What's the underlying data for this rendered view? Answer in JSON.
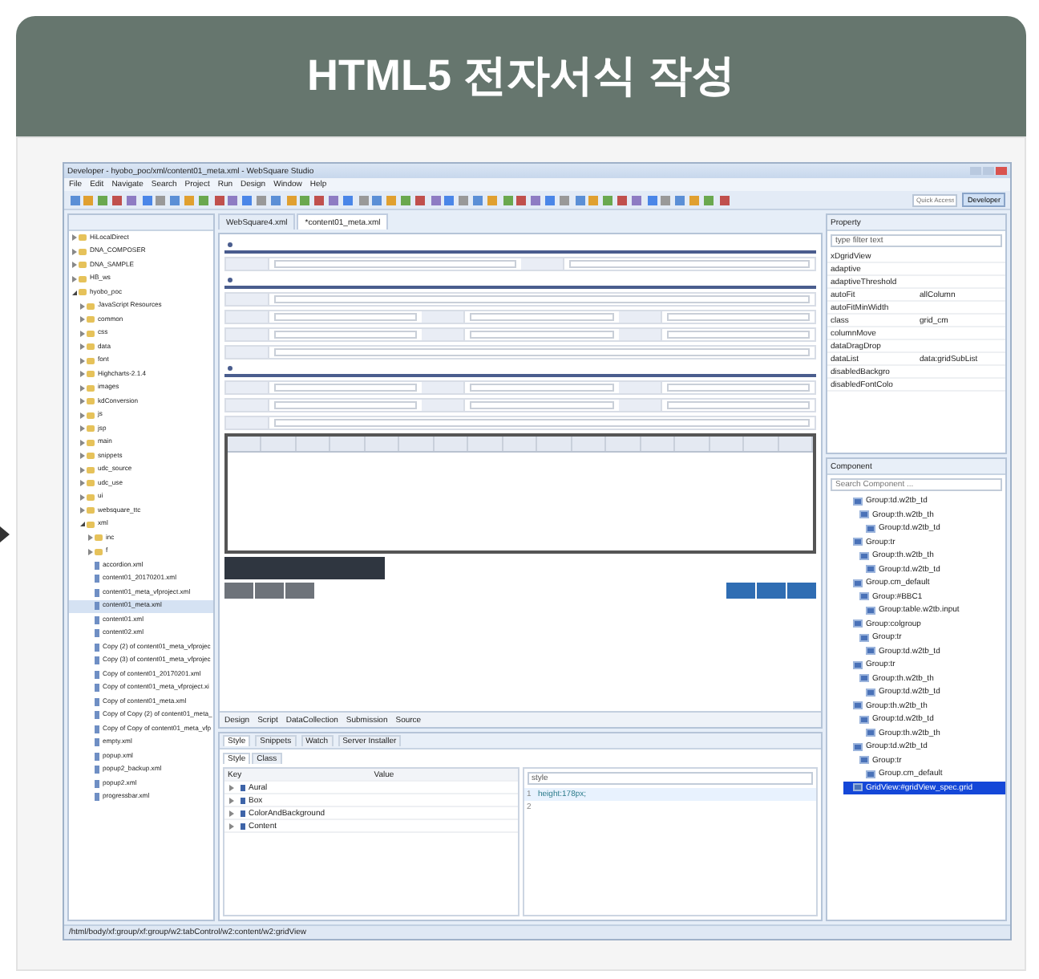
{
  "header": {
    "title": "HTML5 전자서식 작성"
  },
  "ide": {
    "title": "Developer - hyobo_poc/xml/content01_meta.xml - WebSquare Studio",
    "menu": [
      "File",
      "Edit",
      "Navigate",
      "Search",
      "Project",
      "Run",
      "Design",
      "Window",
      "Help"
    ],
    "quick_access": {
      "placeholder": "Quick Access"
    },
    "perspective": "Developer",
    "navigator": {
      "tree": [
        {
          "label": "HiLocalDirect",
          "expanded": false
        },
        {
          "label": "DNA_COMPOSER",
          "expanded": false
        },
        {
          "label": "DNA_SAMPLE",
          "expanded": false
        },
        {
          "label": "HB_ws",
          "expanded": false
        },
        {
          "label": "hyobo_poc",
          "expanded": true,
          "children": [
            {
              "label": "JavaScript Resources",
              "expanded": false
            },
            {
              "label": "common",
              "expanded": false
            },
            {
              "label": "css",
              "expanded": false
            },
            {
              "label": "data",
              "expanded": false
            },
            {
              "label": "font",
              "expanded": false
            },
            {
              "label": "Highcharts-2.1.4",
              "expanded": false
            },
            {
              "label": "images",
              "expanded": false
            },
            {
              "label": "kdConversion",
              "expanded": false
            },
            {
              "label": "js",
              "expanded": false
            },
            {
              "label": "jsp",
              "expanded": false
            },
            {
              "label": "main",
              "expanded": false
            },
            {
              "label": "snippets",
              "expanded": false
            },
            {
              "label": "udc_source",
              "expanded": false
            },
            {
              "label": "udc_use",
              "expanded": false
            },
            {
              "label": "ui",
              "expanded": false
            },
            {
              "label": "websquare_ttc",
              "expanded": false
            },
            {
              "label": "xml",
              "expanded": true,
              "children": [
                {
                  "label": "inc",
                  "expanded": false
                },
                {
                  "label": "f",
                  "expanded": false
                },
                {
                  "label": "accordion.xml",
                  "selected": false
                },
                {
                  "label": "content01_20170201.xml",
                  "selected": false
                },
                {
                  "label": "content01_meta_vfproject.xml",
                  "selected": false
                },
                {
                  "label": "content01_meta.xml",
                  "selected": true
                },
                {
                  "label": "content01.xml",
                  "selected": false
                },
                {
                  "label": "content02.xml",
                  "selected": false
                },
                {
                  "label": "Copy (2) of content01_meta_vfprojec",
                  "selected": false
                },
                {
                  "label": "Copy (3) of content01_meta_vfprojec",
                  "selected": false
                },
                {
                  "label": "Copy of content01_20170201.xml",
                  "selected": false
                },
                {
                  "label": "Copy of content01_meta_vfproject.xi",
                  "selected": false
                },
                {
                  "label": "Copy of content01_meta.xml",
                  "selected": false
                },
                {
                  "label": "Copy of Copy (2) of content01_meta_",
                  "selected": false
                },
                {
                  "label": "Copy of Copy of content01_meta_vfp",
                  "selected": false
                },
                {
                  "label": "empty.xml",
                  "selected": false
                },
                {
                  "label": "popup.xml",
                  "selected": false
                },
                {
                  "label": "popup2_backup.xml",
                  "selected": false
                },
                {
                  "label": "popup2.xml",
                  "selected": false
                },
                {
                  "label": "progressbar.xml",
                  "selected": false
                }
              ]
            }
          ]
        }
      ]
    },
    "editor_tabs": [
      {
        "label": "WebSquare4.xml",
        "selected": false
      },
      {
        "label": "*content01_meta.xml",
        "selected": true
      }
    ],
    "bottom_tabs": [
      "Design",
      "Script",
      "DataCollection",
      "Submission",
      "Source"
    ],
    "style_view": {
      "tabs": [
        {
          "label": "Style",
          "selected": true
        },
        {
          "label": "Snippets",
          "selected": false
        },
        {
          "label": "Watch",
          "selected": false
        },
        {
          "label": "Server Installer",
          "selected": false
        }
      ],
      "subtabs": [
        {
          "label": "Style",
          "selected": true
        },
        {
          "label": "Class",
          "selected": false
        }
      ],
      "columns": [
        "Key",
        "Value"
      ],
      "keys": [
        "Aural",
        "Box",
        "ColorAndBackground",
        "Content"
      ],
      "selector": "style",
      "code": [
        {
          "line": "1",
          "text": "height:178px;"
        },
        {
          "line": "2"
        }
      ]
    },
    "property": {
      "title": "Property",
      "filter": "type filter text",
      "rows": [
        {
          "key": "xDgridView"
        },
        {
          "key": "adaptive"
        },
        {
          "key": "adaptiveThreshold"
        },
        {
          "key": "autoFit",
          "value": "allColumn"
        },
        {
          "key": "autoFitMinWidth"
        },
        {
          "key": "class",
          "value": "grid_cm"
        },
        {
          "key": "columnMove"
        },
        {
          "key": "dataDragDrop"
        },
        {
          "key": "dataList",
          "value": "data:gridSubList"
        },
        {
          "key": "disabledBackgro"
        },
        {
          "key": "disabledFontColo"
        }
      ]
    },
    "component": {
      "title": "Component",
      "search": {
        "placeholder": "Search Component ..."
      },
      "tree": [
        {
          "label": "Group:td.w2tb_td",
          "selected": false
        },
        {
          "label": "Group:th.w2tb_th",
          "selected": false
        },
        {
          "label": "Group:td.w2tb_td",
          "selected": false
        },
        {
          "label": "Group:tr",
          "selected": false
        },
        {
          "label": "Group:th.w2tb_th",
          "selected": false
        },
        {
          "label": "Group:td.w2tb_td",
          "selected": false
        },
        {
          "label": "Group.cm_default",
          "selected": false
        },
        {
          "label": "Group:#BBC1",
          "selected": false
        },
        {
          "label": "Group:table.w2tb.input",
          "selected": false
        },
        {
          "label": "Group:colgroup",
          "selected": false
        },
        {
          "label": "Group:tr",
          "selected": false
        },
        {
          "label": "Group:td.w2tb_td",
          "selected": false
        },
        {
          "label": "Group:tr",
          "selected": false
        },
        {
          "label": "Group:th.w2tb_th",
          "selected": false
        },
        {
          "label": "Group:td.w2tb_td",
          "selected": false
        },
        {
          "label": "Group:th.w2tb_th",
          "selected": false
        },
        {
          "label": "Group:td.w2tb_td",
          "selected": false
        },
        {
          "label": "Group:th.w2tb_th",
          "selected": false
        },
        {
          "label": "Group:td.w2tb_td",
          "selected": false
        },
        {
          "label": "Group:tr",
          "selected": false
        },
        {
          "label": "Group.cm_default",
          "selected": false
        },
        {
          "label": "GridView:#gridView_spec.grid",
          "selected": true
        }
      ]
    },
    "status": "/html/body/xf:group/xf:group/w2:tabControl/w2:content/w2:gridView"
  }
}
